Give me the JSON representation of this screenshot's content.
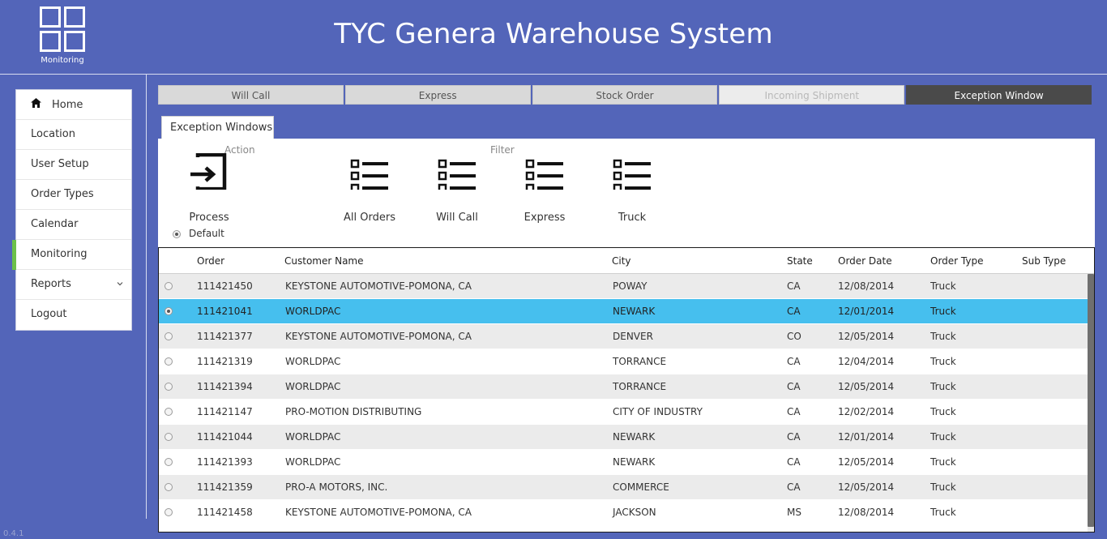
{
  "header": {
    "title": "TYC Genera Warehouse System",
    "logo_label": "Monitoring",
    "logo_icon": "grid-icon"
  },
  "sidebar": {
    "items": [
      {
        "label": "Home",
        "icon": "home-icon"
      },
      {
        "label": "Location"
      },
      {
        "label": "User Setup"
      },
      {
        "label": "Order Types"
      },
      {
        "label": "Calendar"
      },
      {
        "label": "Monitoring",
        "active": true
      },
      {
        "label": "Reports",
        "icon": "chevron-down-icon"
      },
      {
        "label": "Logout"
      }
    ],
    "active_color": "#6cc04a"
  },
  "top_tabs": [
    {
      "label": "Will Call"
    },
    {
      "label": "Express"
    },
    {
      "label": "Stock Order"
    },
    {
      "label": "Incoming Shipment",
      "state": "disabled"
    },
    {
      "label": "Exception Window",
      "state": "selected"
    }
  ],
  "sub_tab": {
    "label": "Exception Windows"
  },
  "toolbar": {
    "action_label": "Action",
    "filter_label": "Filter",
    "process_label": "Process",
    "filters": [
      {
        "label": "All Orders"
      },
      {
        "label": "Will Call"
      },
      {
        "label": "Express"
      },
      {
        "label": "Truck"
      }
    ],
    "default_label": "Default"
  },
  "grid": {
    "columns": [
      "Order",
      "Customer Name",
      "City",
      "State",
      "Order Date",
      "Order Type",
      "Sub Type"
    ],
    "rows": [
      {
        "order": "111421450",
        "customer": "KEYSTONE AUTOMOTIVE-POMONA, CA",
        "city": "POWAY",
        "state": "CA",
        "date": "12/08/2014",
        "type": "Truck",
        "sub": ""
      },
      {
        "order": "111421041",
        "customer": "WORLDPAC",
        "city": "NEWARK",
        "state": "CA",
        "date": "12/01/2014",
        "type": "Truck",
        "sub": "",
        "selected": true
      },
      {
        "order": "111421377",
        "customer": "KEYSTONE AUTOMOTIVE-POMONA, CA",
        "city": "DENVER",
        "state": "CO",
        "date": "12/05/2014",
        "type": "Truck",
        "sub": ""
      },
      {
        "order": "111421319",
        "customer": "WORLDPAC",
        "city": "TORRANCE",
        "state": "CA",
        "date": "12/04/2014",
        "type": "Truck",
        "sub": ""
      },
      {
        "order": "111421394",
        "customer": "WORLDPAC",
        "city": "TORRANCE",
        "state": "CA",
        "date": "12/05/2014",
        "type": "Truck",
        "sub": ""
      },
      {
        "order": "111421147",
        "customer": "PRO-MOTION DISTRIBUTING",
        "city": "CITY OF INDUSTRY",
        "state": "CA",
        "date": "12/02/2014",
        "type": "Truck",
        "sub": ""
      },
      {
        "order": "111421044",
        "customer": "WORLDPAC",
        "city": "NEWARK",
        "state": "CA",
        "date": "12/01/2014",
        "type": "Truck",
        "sub": ""
      },
      {
        "order": "111421393",
        "customer": "WORLDPAC",
        "city": "NEWARK",
        "state": "CA",
        "date": "12/05/2014",
        "type": "Truck",
        "sub": ""
      },
      {
        "order": "111421359",
        "customer": "PRO-A MOTORS, INC.",
        "city": "COMMERCE",
        "state": "CA",
        "date": "12/05/2014",
        "type": "Truck",
        "sub": ""
      },
      {
        "order": "111421458",
        "customer": "KEYSTONE AUTOMOTIVE-POMONA, CA",
        "city": "JACKSON",
        "state": "MS",
        "date": "12/08/2014",
        "type": "Truck",
        "sub": ""
      }
    ],
    "selected_color": "#46bfee"
  },
  "version": "0.4.1",
  "colors": {
    "background": "#5365b9",
    "selected_tab": "#4a4a4a"
  }
}
